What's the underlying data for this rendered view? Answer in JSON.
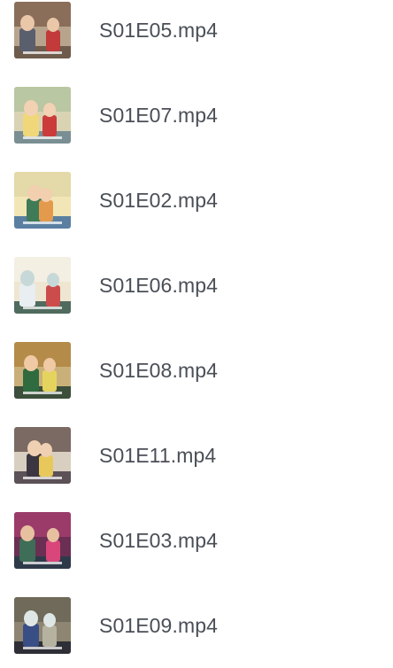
{
  "files": [
    {
      "name": "S01E05.mp4",
      "thumbnail": "video-thumbnail",
      "colors": {
        "bg": "#b8a48c",
        "wall": "#8a6e5a",
        "figure": "#5a5f6e",
        "face": "#e9c7a8",
        "accent": "#c23a3a",
        "floor": "#6e5b4b"
      }
    },
    {
      "name": "S01E07.mp4",
      "thumbnail": "video-thumbnail",
      "colors": {
        "bg": "#d9d3b4",
        "wall": "#b9c7a2",
        "figure": "#f0d77a",
        "face": "#f2d2b3",
        "accent": "#cc3b3b",
        "floor": "#7a8f93"
      }
    },
    {
      "name": "S01E02.mp4",
      "thumbnail": "video-thumbnail",
      "colors": {
        "bg": "#f2e6b6",
        "wall": "#e4d9a8",
        "figure": "#3f7b57",
        "face": "#f2cfae",
        "accent": "#e49a4c",
        "floor": "#5a7fa1"
      }
    },
    {
      "name": "S01E06.mp4",
      "thumbnail": "video-thumbnail",
      "colors": {
        "bg": "#efe6d2",
        "wall": "#f3efe2",
        "figure": "#e8eef2",
        "face": "#c7d8d8",
        "accent": "#cc4c4c",
        "floor": "#4f6b5e"
      }
    },
    {
      "name": "S01E08.mp4",
      "thumbnail": "video-thumbnail",
      "colors": {
        "bg": "#c9b07a",
        "wall": "#b58b4a",
        "figure": "#2f6b3f",
        "face": "#f0c9a5",
        "accent": "#e4d45e",
        "floor": "#3c4f3a"
      }
    },
    {
      "name": "S01E11.mp4",
      "thumbnail": "video-thumbnail",
      "colors": {
        "bg": "#d9cfc1",
        "wall": "#7a6a63",
        "figure": "#3b3641",
        "face": "#f0d0b2",
        "accent": "#e8c85a",
        "floor": "#5b5157"
      }
    },
    {
      "name": "S01E03.mp4",
      "thumbnail": "video-thumbnail",
      "colors": {
        "bg": "#6b2f54",
        "wall": "#9b3b6a",
        "figure": "#3e6e57",
        "face": "#e7c0a0",
        "accent": "#d9467a",
        "floor": "#2e3a4a"
      }
    },
    {
      "name": "S01E09.mp4",
      "thumbnail": "video-thumbnail",
      "colors": {
        "bg": "#8e8572",
        "wall": "#6f6a5a",
        "figure": "#3a4e86",
        "face": "#dfe7e6",
        "accent": "#b5b2a0",
        "floor": "#2e2f36"
      }
    }
  ]
}
